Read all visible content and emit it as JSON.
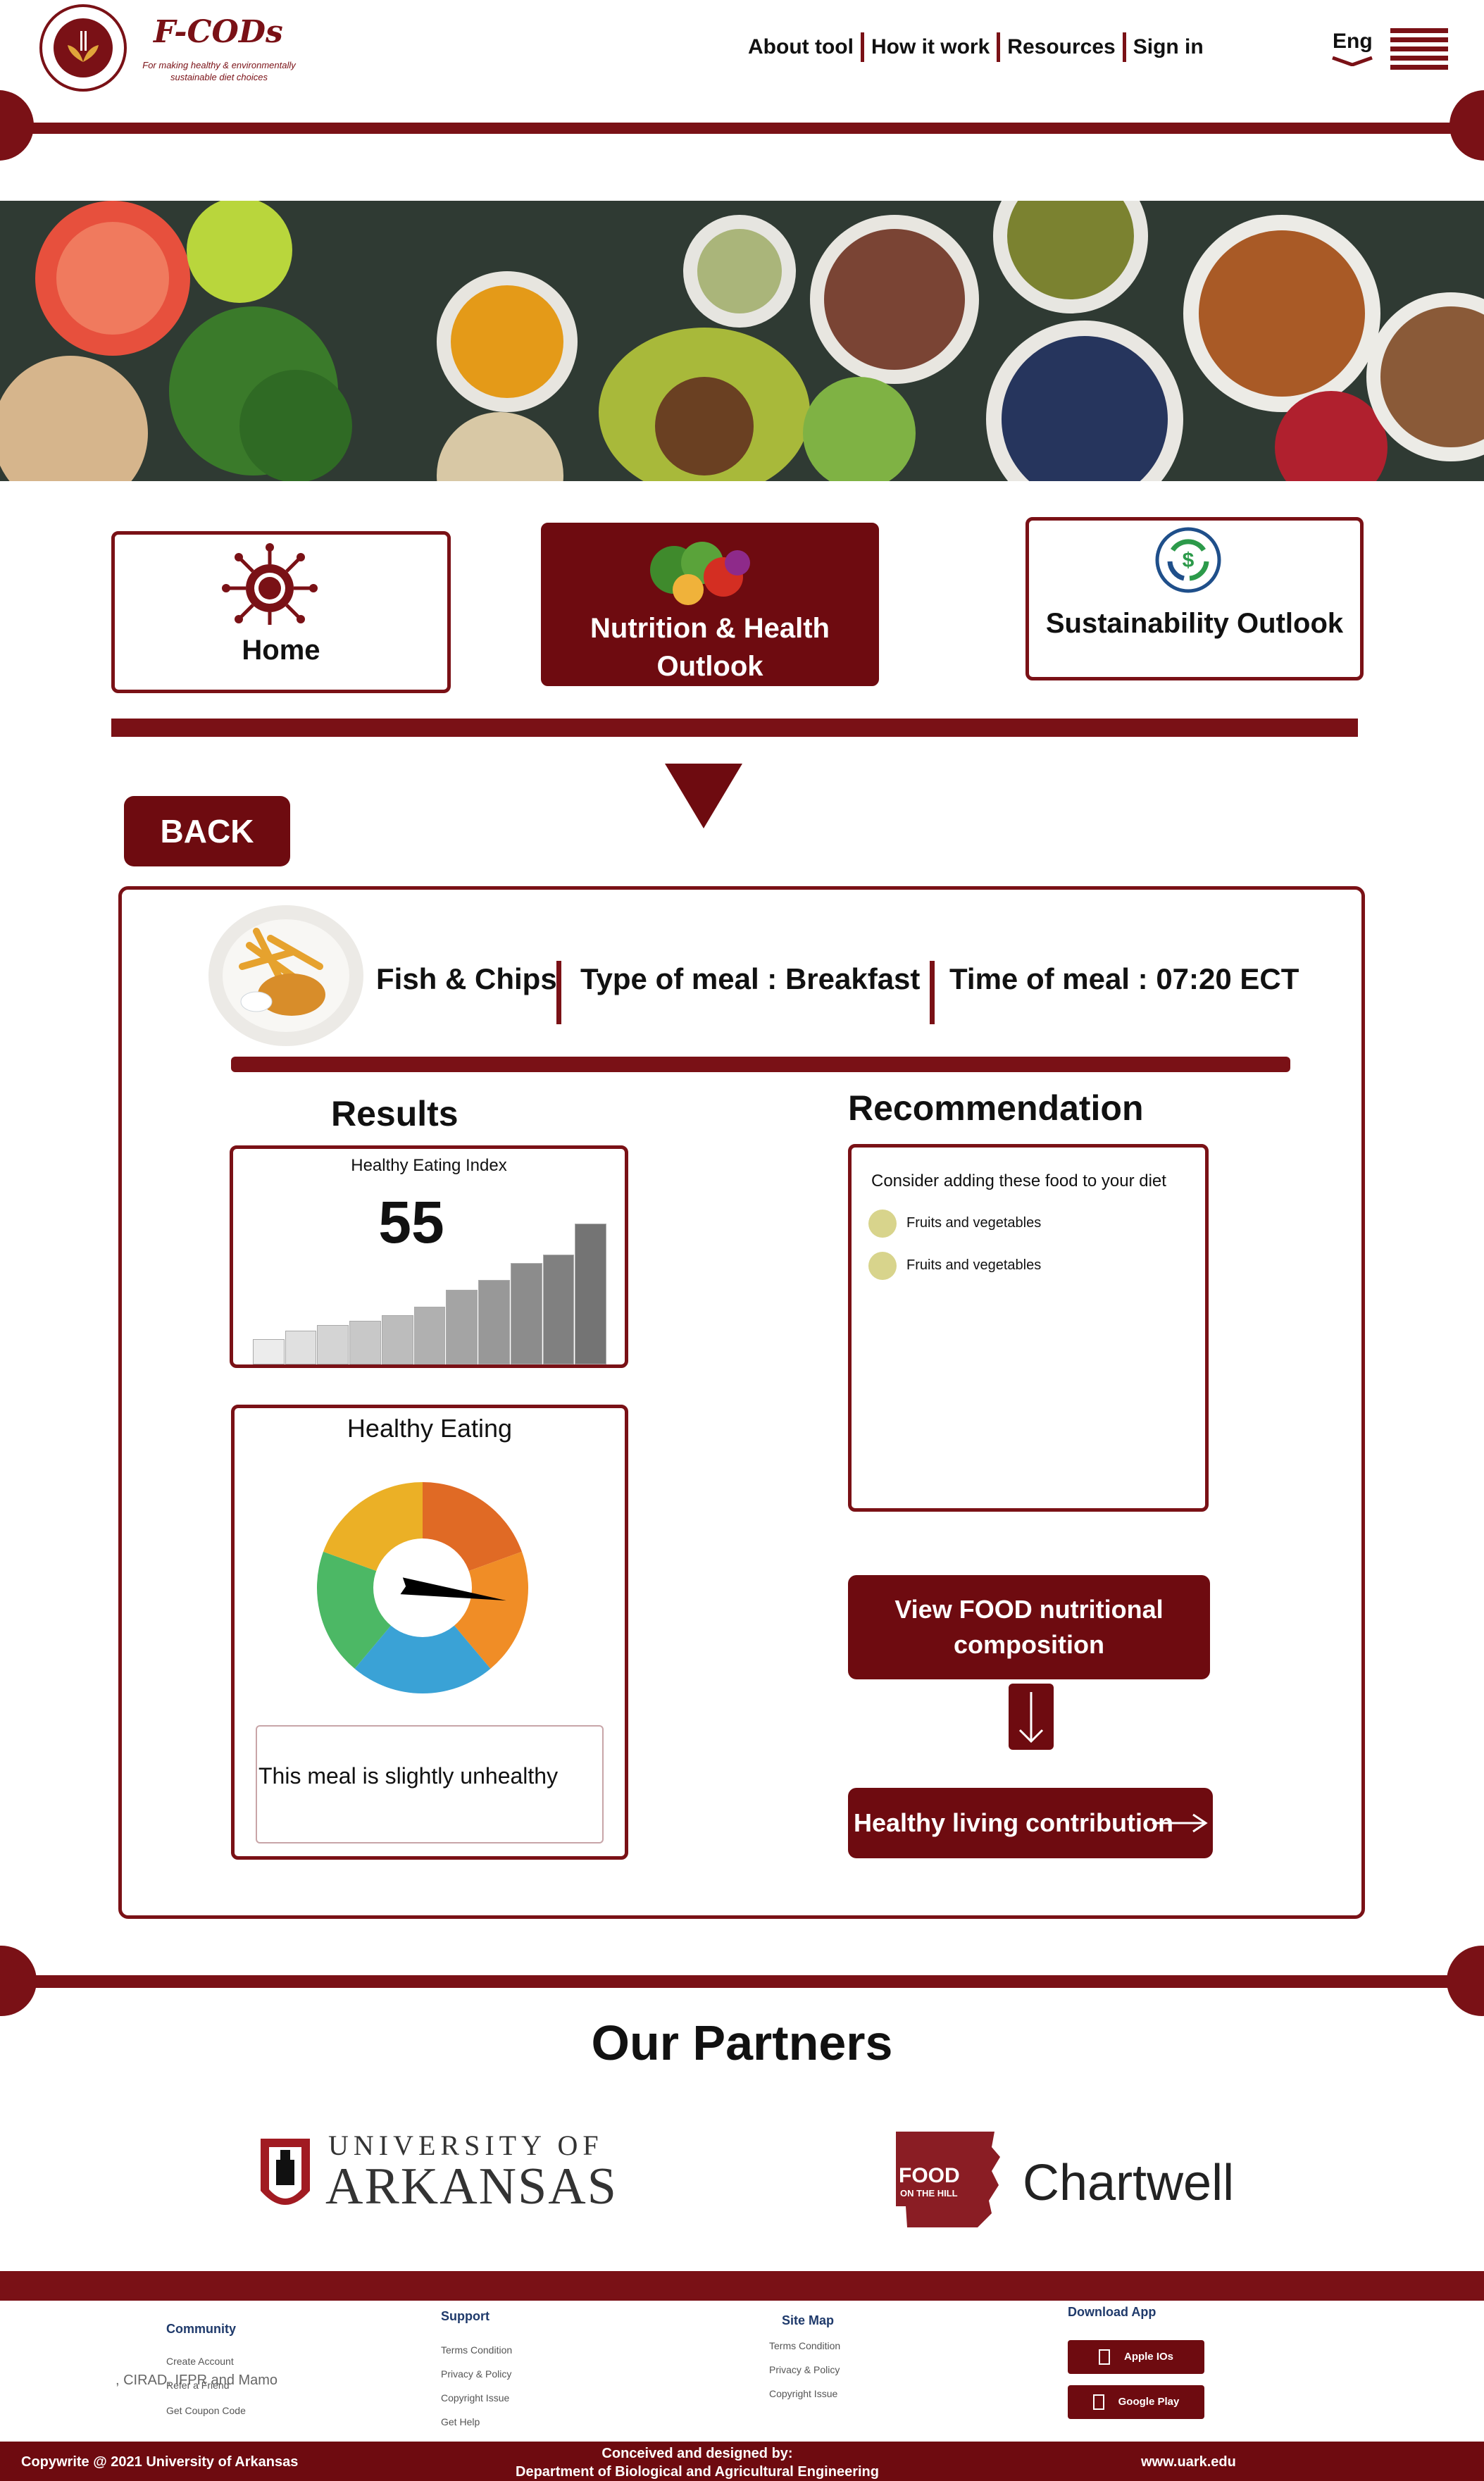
{
  "header": {
    "brand": "F-CODs",
    "tagline": "For making healthy & environmentally sustainable diet choices",
    "nav": [
      "About tool",
      "How it work",
      "Resources",
      "Sign in"
    ],
    "language": "Eng"
  },
  "tabs": {
    "home": "Home",
    "nutrition": "Nutrition & Health Outlook",
    "sustainability": "Sustainability Outlook"
  },
  "back_label": "BACK",
  "meal": {
    "name": "Fish & Chips",
    "type_label": "Type of meal :",
    "type_value": "Breakfast",
    "time_label": "Time of meal :",
    "time_value": "07:20 ECT"
  },
  "results": {
    "heading": "Results",
    "hei_label": "Healthy Eating  Index",
    "hei_value": "55",
    "bar_levels": [
      0.18,
      0.24,
      0.28,
      0.31,
      0.35,
      0.41,
      0.53,
      0.6,
      0.72,
      0.78,
      1.0
    ],
    "gauge_title": "Healthy Eating",
    "gauge_needle_deg": 8,
    "verdict": "This meal is slightly unhealthy",
    "colors": {
      "gauge_orange_dark": "#e06a25",
      "gauge_orange": "#f08d26",
      "gauge_blue": "#3aa2d6",
      "gauge_green": "#4cb865",
      "gauge_yellow": "#ebb026"
    }
  },
  "recommendation": {
    "heading": "Recommendation",
    "intro": "Consider adding these food to your diet",
    "items": [
      "Fruits and vegetables",
      "Fruits and vegetables"
    ],
    "view_button": "View FOOD nutritional composition",
    "contribution_button": "Healthy living contribution"
  },
  "partners": {
    "title": "Our Partners",
    "uark_top": "UNIVERSITY OF",
    "uark_bottom": "ARKANSAS",
    "food_hill_top": "FOOD",
    "food_hill_bottom": "ON THE HILL",
    "chartwell": "Chartwell"
  },
  "footer": {
    "community_title": "Community",
    "community_links": [
      "Create Account",
      "Refer a Friend",
      "Get Coupon Code"
    ],
    "overlap_text": ", CIRAD, IFPR and Mamo",
    "support_title": "Support",
    "support_links": [
      "Terms  Condition",
      "Privacy & Policy",
      "Copyright Issue",
      "Get Help"
    ],
    "sitemap_title": "Site Map",
    "sitemap_links": [
      "Terms  Condition",
      "Privacy & Policy",
      "Copyright Issue"
    ],
    "download_title": "Download App",
    "apple": "Apple IOs",
    "google": "Google Play",
    "copyright": "Copywrite @ 2021 University of Arkansas",
    "conceived_1": "Conceived and designed by:",
    "conceived_2": "Department of Biological and Agricultural Engineering",
    "website": "www.uark.edu"
  },
  "brand_color": "#6e0b10"
}
